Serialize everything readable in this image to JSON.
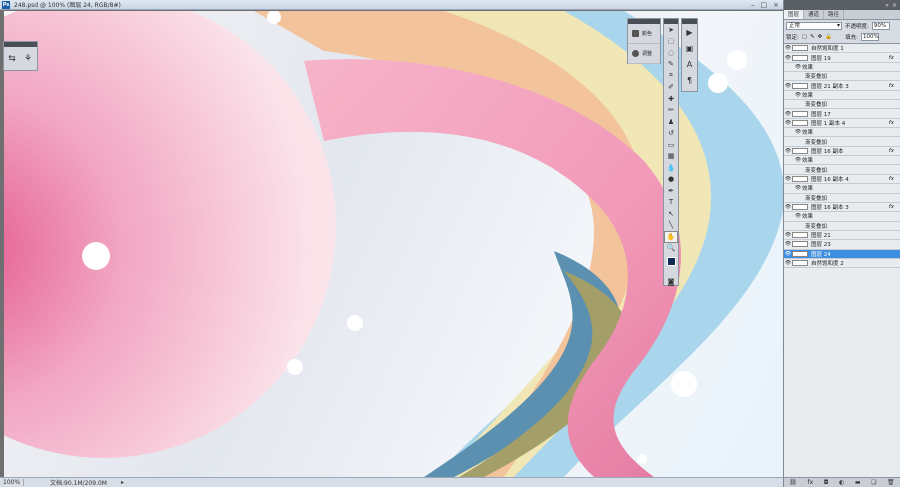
{
  "window": {
    "title": "248.psd @ 100% (图层 24, RGB/8#)",
    "app_icon": "Ps"
  },
  "status": {
    "zoom": "100%",
    "doc": "文档:90.1M/209.0M"
  },
  "adjust_panel": {
    "items": [
      {
        "label": "颜色"
      },
      {
        "label": "调整"
      }
    ]
  },
  "layers_panel": {
    "tabs": [
      "图层",
      "通道",
      "路径"
    ],
    "blend_mode": "正常",
    "opacity_label": "不透明度:",
    "opacity_value": "90%",
    "lock_label": "锁定:",
    "fill_label": "填充:",
    "fill_value": "100%",
    "rows": [
      {
        "name": "自然饱和度 1",
        "type": "layer",
        "fx": false,
        "selected": false
      },
      {
        "name": "图层 19",
        "type": "layer",
        "fx": true,
        "selected": false
      },
      {
        "name": "效果",
        "type": "effects",
        "fx": false,
        "selected": false
      },
      {
        "name": "渐变叠加",
        "type": "effect",
        "fx": false,
        "selected": false
      },
      {
        "name": "图层 21 副本 3",
        "type": "layer",
        "fx": true,
        "selected": false
      },
      {
        "name": "效果",
        "type": "effects",
        "fx": false,
        "selected": false
      },
      {
        "name": "渐变叠加",
        "type": "effect",
        "fx": false,
        "selected": false
      },
      {
        "name": "图层 17",
        "type": "layer",
        "fx": false,
        "selected": false
      },
      {
        "name": "图层 1 副本 4",
        "type": "layer",
        "fx": true,
        "selected": false
      },
      {
        "name": "效果",
        "type": "effects",
        "fx": false,
        "selected": false
      },
      {
        "name": "渐变叠加",
        "type": "effect",
        "fx": false,
        "selected": false
      },
      {
        "name": "图层 16 副本",
        "type": "layer",
        "fx": true,
        "selected": false
      },
      {
        "name": "效果",
        "type": "effects",
        "fx": false,
        "selected": false
      },
      {
        "name": "渐变叠加",
        "type": "effect",
        "fx": false,
        "selected": false
      },
      {
        "name": "图层 16 副本 4",
        "type": "layer",
        "fx": true,
        "selected": false
      },
      {
        "name": "效果",
        "type": "effects",
        "fx": false,
        "selected": false
      },
      {
        "name": "渐变叠加",
        "type": "effect",
        "fx": false,
        "selected": false
      },
      {
        "name": "图层 16 副本 3",
        "type": "layer",
        "fx": true,
        "selected": false
      },
      {
        "name": "效果",
        "type": "effects",
        "fx": false,
        "selected": false
      },
      {
        "name": "渐变叠加",
        "type": "effect",
        "fx": false,
        "selected": false
      },
      {
        "name": "图层 21",
        "type": "layer",
        "fx": false,
        "selected": false
      },
      {
        "name": "图层 23",
        "type": "layer",
        "fx": false,
        "selected": false
      },
      {
        "name": "图层 24",
        "type": "layer",
        "fx": false,
        "selected": true
      },
      {
        "name": "自然饱和度 2",
        "type": "layer",
        "fx": false,
        "selected": false
      }
    ]
  },
  "colors": {
    "selection": "#3d8ee0",
    "foreground": "#0e2a55",
    "pink": "#e96d9a"
  }
}
